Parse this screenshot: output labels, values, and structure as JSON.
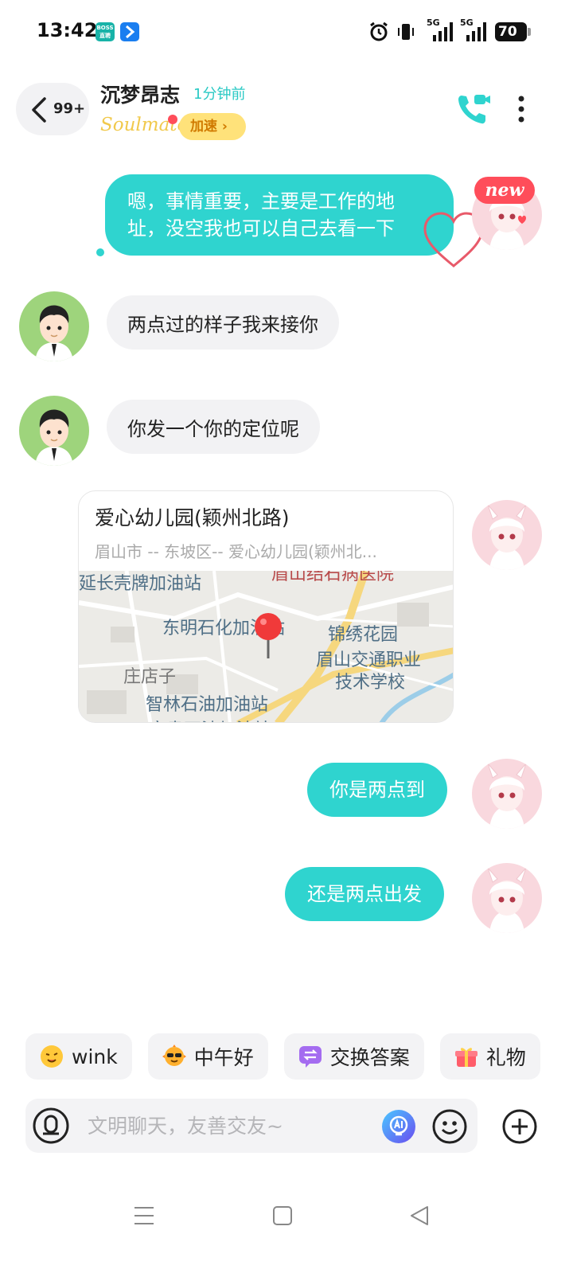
{
  "status_bar": {
    "time": "13:42",
    "boss_badge": "BOSS直聘",
    "network_1": "5G",
    "network_2": "5G",
    "battery": "70"
  },
  "header": {
    "back_icon": "chevron-left-icon",
    "unread_count": "99+",
    "contact_name": "沉梦昂志",
    "last_seen": "1分钟前",
    "soulmate_label": "Soulmate",
    "boost_label": "加速 ›",
    "call_icon": "video-call-icon",
    "more_icon": "more-vertical-icon"
  },
  "messages": [
    {
      "direction": "out",
      "text": "嗯，事情重要，主要是工作的地址，没空我也可以自己去看一下",
      "tag": "new"
    },
    {
      "direction": "in",
      "text": "两点过的样子我来接你"
    },
    {
      "direction": "in",
      "text": "你发一个你的定位呢"
    },
    {
      "direction": "out",
      "type": "location",
      "name": "爱心幼儿园(颖州北路)",
      "address": "眉山市 -- 东坡区-- 爱心幼儿园(颖州北...",
      "map_labels": [
        "延长壳牌加油站",
        "眉山结石病医院",
        "东明石化加油站",
        "锦绣花园",
        "眉山交通职业",
        "技术学校",
        "庄店子",
        "智林石油加油站",
        "富贵石油加油站"
      ]
    },
    {
      "direction": "out",
      "text": "你是两点到"
    },
    {
      "direction": "out",
      "text": "还是两点出发"
    }
  ],
  "quick_replies": [
    {
      "icon": "wink-emoji-icon",
      "label": "wink"
    },
    {
      "icon": "sunglasses-emoji-icon",
      "label": "中午好"
    },
    {
      "icon": "exchange-icon",
      "label": "交换答案"
    },
    {
      "icon": "gift-icon",
      "label": "礼物"
    }
  ],
  "input": {
    "placeholder": "文明聊天，友善交友~",
    "value": ""
  },
  "colors": {
    "accent": "#2fd4cf",
    "incoming_bubble": "#f2f2f4",
    "badge_red": "#ff4d5a",
    "boost_yellow": "#ffe27a"
  }
}
